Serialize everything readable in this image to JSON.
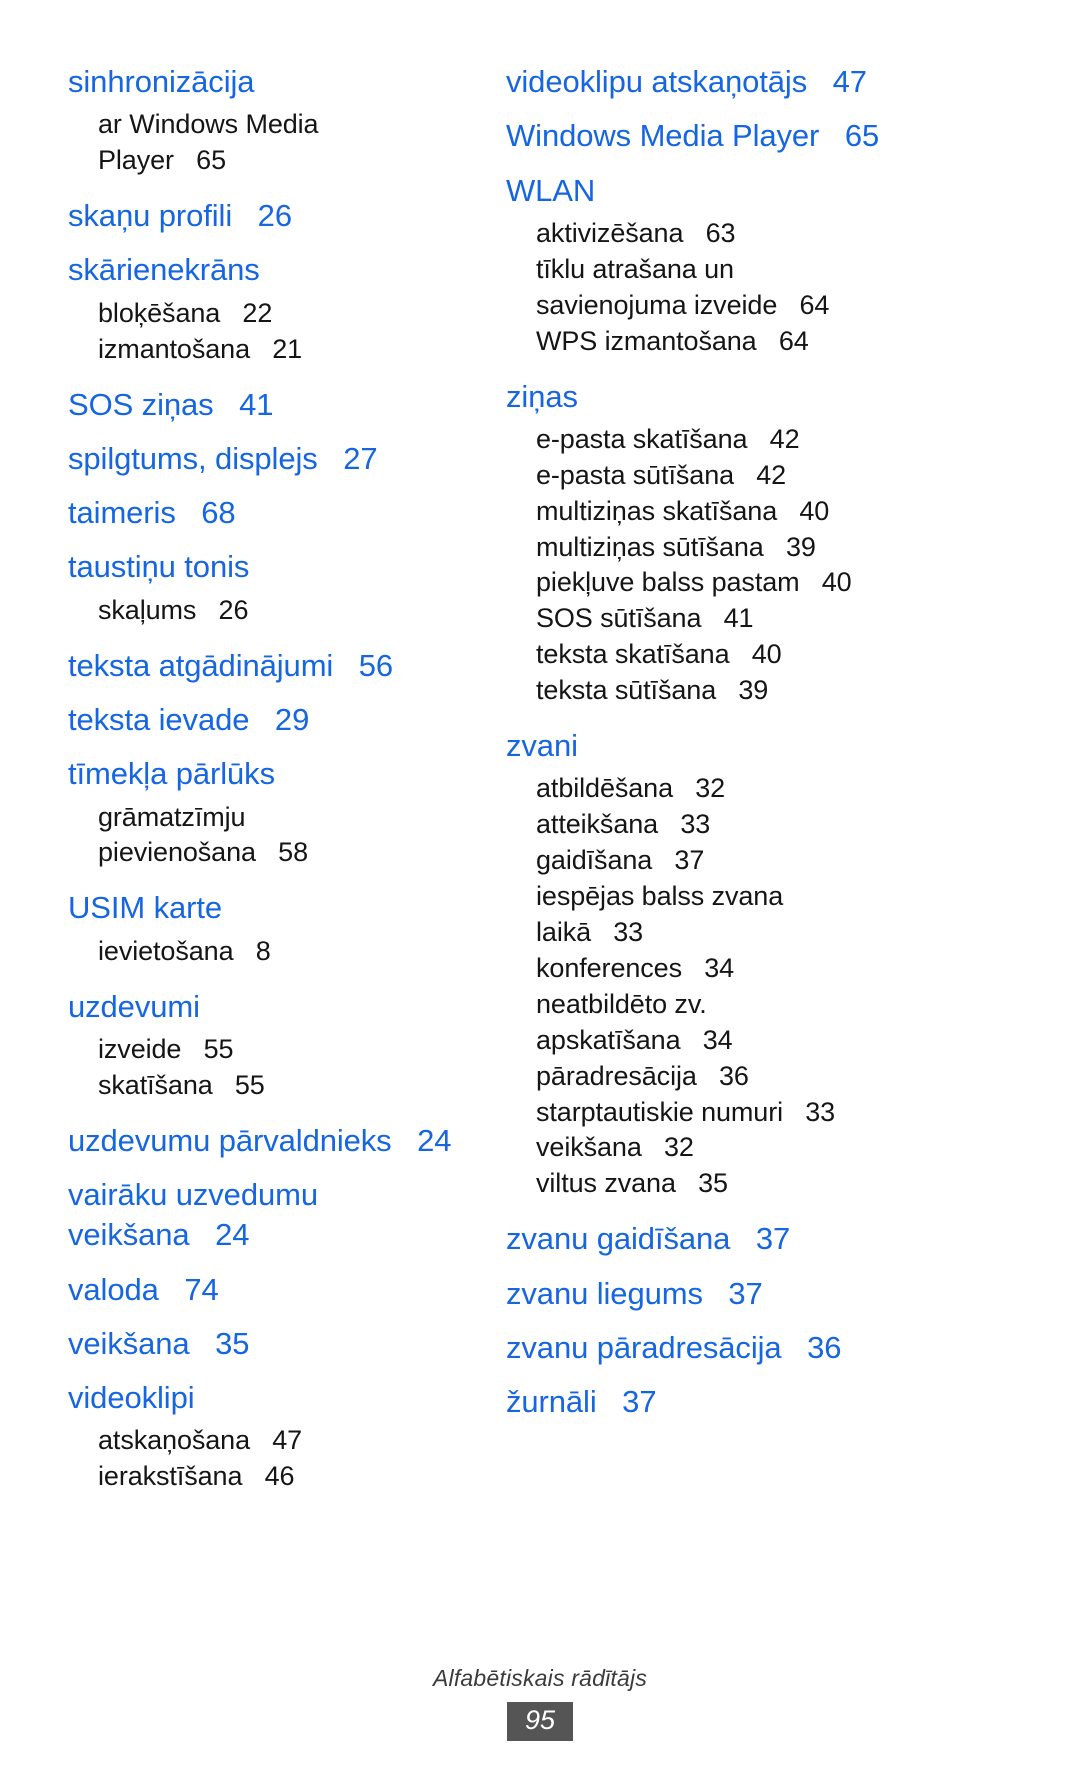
{
  "document": {
    "type": "index",
    "footer_label": "Alfabētiskais rādītājs",
    "page_number": "95",
    "accent_color": "#1566e0",
    "text_color": "#151515",
    "footer_box_color": "#555555"
  },
  "left_column": [
    {
      "level": "head",
      "text": "sinhronizācija",
      "page": ""
    },
    {
      "level": "sub",
      "text": "ar Windows Media\nPlayer",
      "page": "65"
    },
    {
      "level": "head",
      "text": "skaņu profili",
      "page": "26"
    },
    {
      "level": "head",
      "text": "skārienekrāns",
      "page": ""
    },
    {
      "level": "sub",
      "text": "bloķēšana",
      "page": "22"
    },
    {
      "level": "sub",
      "text": "izmantošana",
      "page": "21"
    },
    {
      "level": "head",
      "text": "SOS ziņas",
      "page": "41"
    },
    {
      "level": "head",
      "text": "spilgtums, displejs",
      "page": "27"
    },
    {
      "level": "head",
      "text": "taimeris",
      "page": "68"
    },
    {
      "level": "head",
      "text": "taustiņu tonis",
      "page": ""
    },
    {
      "level": "sub",
      "text": "skaļums",
      "page": "26"
    },
    {
      "level": "head",
      "text": "teksta atgādinājumi",
      "page": "56"
    },
    {
      "level": "head",
      "text": "teksta ievade",
      "page": "29"
    },
    {
      "level": "head",
      "text": "tīmekļa pārlūks",
      "page": ""
    },
    {
      "level": "sub",
      "text": "grāmatzīmju\npievienošana",
      "page": "58"
    },
    {
      "level": "head",
      "text": "USIM karte",
      "page": ""
    },
    {
      "level": "sub",
      "text": "ievietošana",
      "page": "8"
    },
    {
      "level": "head",
      "text": "uzdevumi",
      "page": ""
    },
    {
      "level": "sub",
      "text": "izveide",
      "page": "55"
    },
    {
      "level": "sub",
      "text": "skatīšana",
      "page": "55"
    },
    {
      "level": "head",
      "text": "uzdevumu pārvaldnieks",
      "page": "24"
    },
    {
      "level": "head",
      "text": "vairāku uzvedumu\nveikšana",
      "page": "24"
    },
    {
      "level": "head",
      "text": "valoda",
      "page": "74"
    },
    {
      "level": "head",
      "text": "veikšana",
      "page": "35"
    },
    {
      "level": "head",
      "text": "videoklipi",
      "page": ""
    },
    {
      "level": "sub",
      "text": "atskaņošana",
      "page": "47"
    },
    {
      "level": "sub",
      "text": "ierakstīšana",
      "page": "46"
    }
  ],
  "right_column": [
    {
      "level": "head",
      "text": "videoklipu atskaņotājs",
      "page": "47"
    },
    {
      "level": "head",
      "text": "Windows Media Player",
      "page": "65"
    },
    {
      "level": "head",
      "text": "WLAN",
      "page": ""
    },
    {
      "level": "sub",
      "text": "aktivizēšana",
      "page": "63"
    },
    {
      "level": "sub",
      "text": "tīklu atrašana un\nsavienojuma izveide",
      "page": "64"
    },
    {
      "level": "sub",
      "text": "WPS izmantošana",
      "page": "64"
    },
    {
      "level": "head",
      "text": "ziņas",
      "page": ""
    },
    {
      "level": "sub",
      "text": "e-pasta skatīšana",
      "page": "42"
    },
    {
      "level": "sub",
      "text": "e-pasta sūtīšana",
      "page": "42"
    },
    {
      "level": "sub",
      "text": "multiziņas skatīšana",
      "page": "40"
    },
    {
      "level": "sub",
      "text": "multiziņas sūtīšana",
      "page": "39"
    },
    {
      "level": "sub",
      "text": "piekļuve balss pastam",
      "page": "40"
    },
    {
      "level": "sub",
      "text": "SOS sūtīšana",
      "page": "41"
    },
    {
      "level": "sub",
      "text": "teksta skatīšana",
      "page": "40"
    },
    {
      "level": "sub",
      "text": "teksta sūtīšana",
      "page": "39"
    },
    {
      "level": "head",
      "text": "zvani",
      "page": ""
    },
    {
      "level": "sub",
      "text": "atbildēšana",
      "page": "32"
    },
    {
      "level": "sub",
      "text": "atteikšana",
      "page": "33"
    },
    {
      "level": "sub",
      "text": "gaidīšana",
      "page": "37"
    },
    {
      "level": "sub",
      "text": "iespējas balss zvana\nlaikā",
      "page": "33"
    },
    {
      "level": "sub",
      "text": "konferences",
      "page": "34"
    },
    {
      "level": "sub",
      "text": "neatbildēto zv.\napskatīšana",
      "page": "34"
    },
    {
      "level": "sub",
      "text": "pāradresācija",
      "page": "36"
    },
    {
      "level": "sub",
      "text": "starptautiskie numuri",
      "page": "33"
    },
    {
      "level": "sub",
      "text": "veikšana",
      "page": "32"
    },
    {
      "level": "sub",
      "text": "viltus zvana",
      "page": "35"
    },
    {
      "level": "head",
      "text": "zvanu gaidīšana",
      "page": "37"
    },
    {
      "level": "head",
      "text": "zvanu liegums",
      "page": "37"
    },
    {
      "level": "head",
      "text": "zvanu pāradresācija",
      "page": "36"
    },
    {
      "level": "head",
      "text": "žurnāli",
      "page": "37"
    }
  ]
}
